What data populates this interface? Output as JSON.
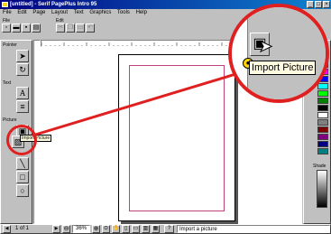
{
  "window": {
    "title": "[untitled] - Serif PagePlus Intro 95"
  },
  "menu": [
    "File",
    "Edit",
    "Page",
    "Layout",
    "Text",
    "Graphics",
    "Tools",
    "Help"
  ],
  "toolbar": {
    "file_group_label": "File",
    "edit_group_label": "Edit"
  },
  "left_panel": {
    "pointer_label": "Pointer",
    "text_label": "Text",
    "picture_label": "Picture",
    "text_tool_glyph": "A"
  },
  "tooltip": {
    "text": "Import Picture"
  },
  "zoom_callout": {
    "text": "Import Picture"
  },
  "right_panel": {
    "shade_label": "Shade"
  },
  "statusbar": {
    "page_indicator": "1 of 1",
    "zoom_level": "36%",
    "status_text": "Import a picture"
  },
  "colors": {
    "title_bar": "#000080",
    "callout": "#e02020",
    "margin_guide": "#c04080",
    "palette": [
      "#ffff00",
      "#ff0000",
      "#ff00ff",
      "#0000ff",
      "#00ffff",
      "#00ff00",
      "#008000",
      "#000000",
      "#ffffff",
      "#808080",
      "#800000",
      "#800080",
      "#000080",
      "#008080"
    ]
  }
}
